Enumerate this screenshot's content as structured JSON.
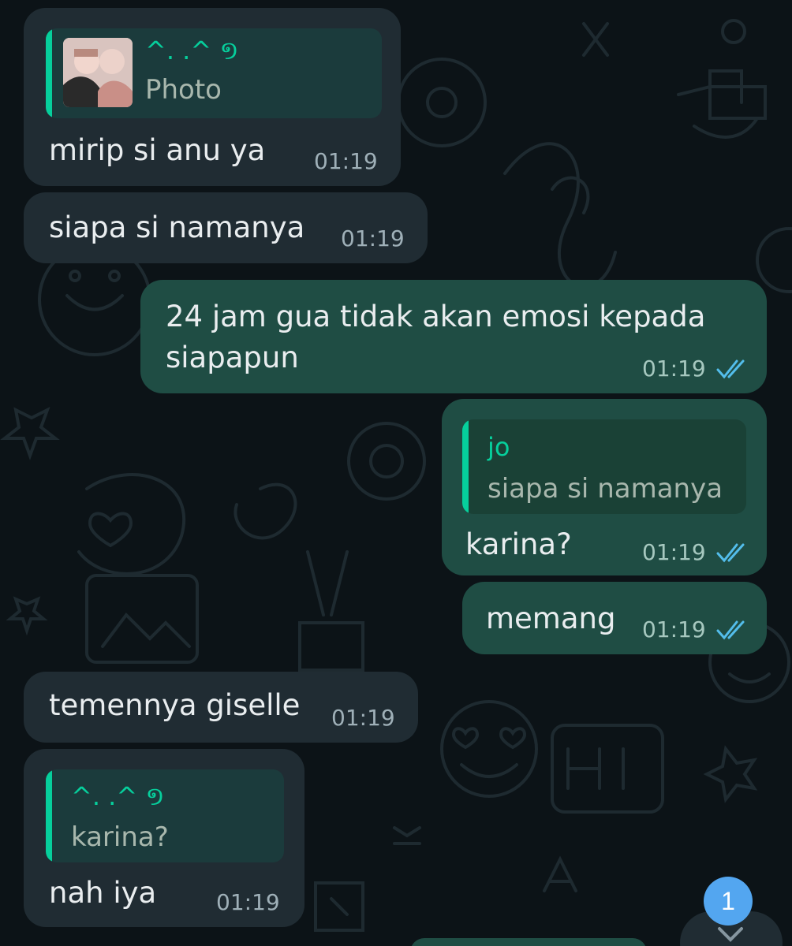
{
  "messages": [
    {
      "direction": "incoming",
      "quote": {
        "author": "^. .^ ១",
        "text": "Photo",
        "thumbnail": "photo-thumbnail"
      },
      "text": "mirip si anu ya",
      "time": "01:19"
    },
    {
      "direction": "incoming",
      "text": "siapa si namanya",
      "time": "01:19"
    },
    {
      "direction": "outgoing",
      "text_line1": "24 jam gua tidak akan emosi kepada",
      "text_line2": "siapapun",
      "time": "01:19",
      "status": "read"
    },
    {
      "direction": "outgoing",
      "quote": {
        "author": "jo",
        "text": "siapa si namanya"
      },
      "text": "karina?",
      "time": "01:19",
      "status": "read"
    },
    {
      "direction": "outgoing",
      "text": "memang",
      "time": "01:19",
      "status": "read"
    },
    {
      "direction": "incoming",
      "text": "temennya giselle",
      "time": "01:19"
    },
    {
      "direction": "incoming",
      "quote": {
        "author": "^. .^ ១",
        "text": "karina?"
      },
      "text": "nah iya",
      "time": "01:19"
    }
  ],
  "unread_badge": "1",
  "colors": {
    "background": "#0c1317",
    "incoming_bubble": "#202c33",
    "outgoing_bubble": "#1f4d44",
    "quote_accent": "#06cf9c",
    "read_tick": "#53bdeb",
    "badge": "#53a6f0"
  },
  "icons": [
    "photo-thumbnail",
    "double-check-icon",
    "chevron-down-icon"
  ]
}
